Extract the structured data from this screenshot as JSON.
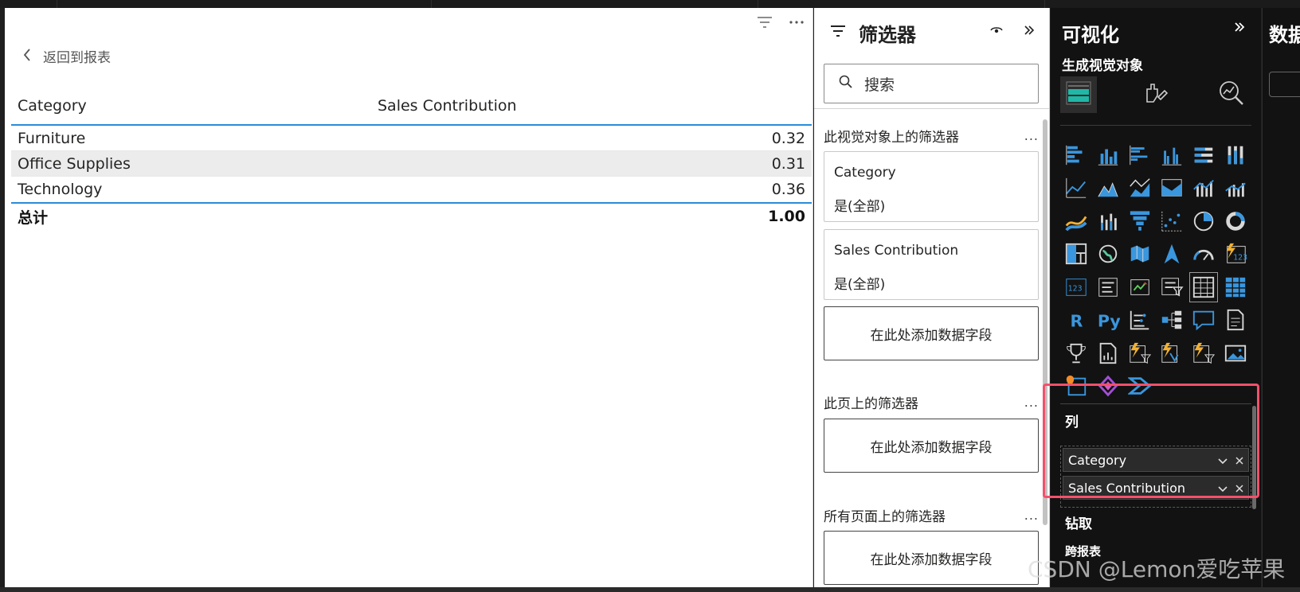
{
  "report": {
    "back_label": "返回到报表",
    "table": {
      "columns": [
        "Category",
        "Sales Contribution"
      ],
      "rows": [
        {
          "category": "Furniture",
          "value": "0.32"
        },
        {
          "category": "Office Supplies",
          "value": "0.31"
        },
        {
          "category": "Technology",
          "value": "0.36"
        }
      ],
      "total": {
        "label": "总计",
        "value": "1.00"
      }
    }
  },
  "filters": {
    "title": "筛选器",
    "search_placeholder": "搜索",
    "visual_section": "此视觉对象上的筛选器",
    "cards": [
      {
        "field": "Category",
        "value": "是(全部)"
      },
      {
        "field": "Sales Contribution",
        "value": "是(全部)"
      }
    ],
    "add_field": "在此处添加数据字段",
    "page_section": "此页上的筛选器",
    "all_pages_section": "所有页面上的筛选器",
    "more": "..."
  },
  "visualizations": {
    "title": "可视化",
    "subtitle": "生成视觉对象",
    "columns_label": "列",
    "fields": [
      "Category",
      "Sales Contribution"
    ],
    "drillthrough_label": "钻取",
    "drill_report_label": "跨报表",
    "more_glyph": "···",
    "r_label": "R",
    "py_label": "Py",
    "accent": "#2a8cd8"
  },
  "data_pane": {
    "title": "数据"
  },
  "watermark": "CSDN @Lemon爱吃苹果"
}
